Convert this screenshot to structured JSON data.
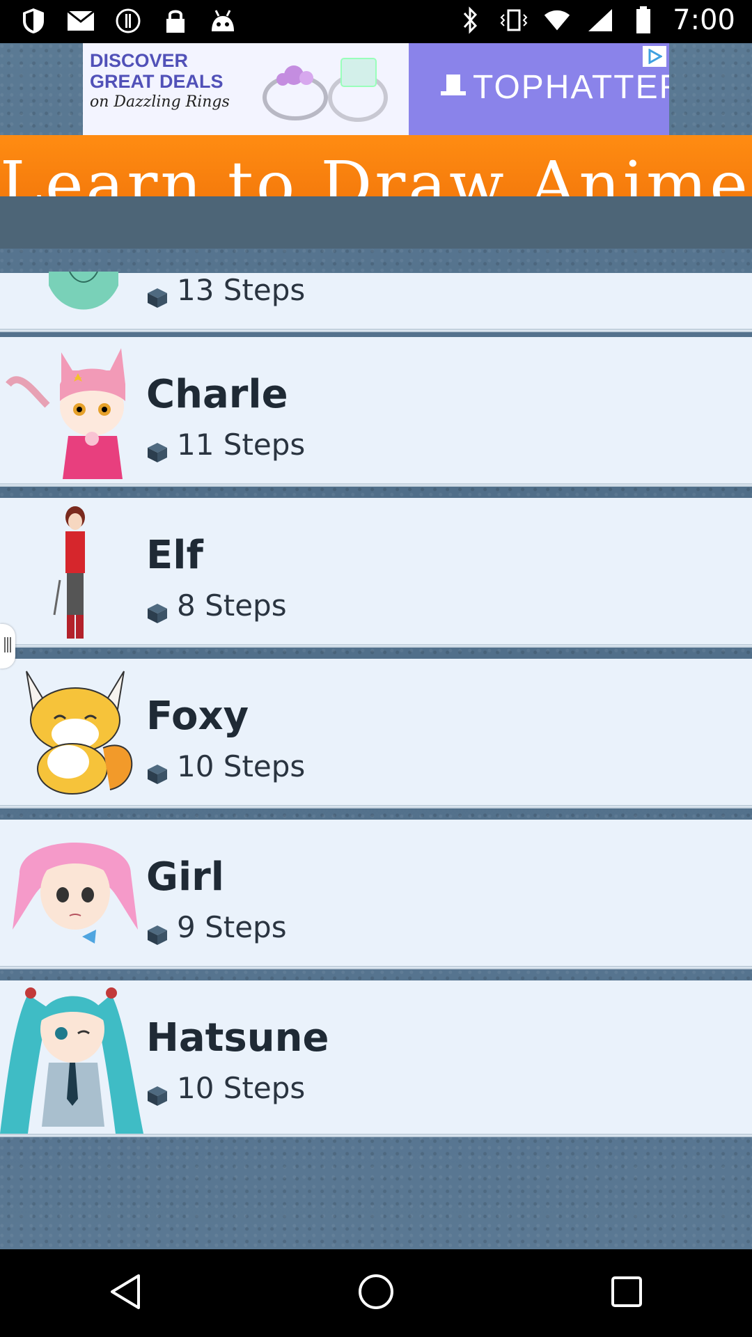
{
  "status_bar": {
    "time": "7:00",
    "left_icons": [
      "shield-icon",
      "mail-icon",
      "alert-icon",
      "lock-icon",
      "android-icon"
    ],
    "right_icons": [
      "bluetooth-icon",
      "vibrate-icon",
      "wifi-icon",
      "signal-icon",
      "battery-icon"
    ]
  },
  "ad": {
    "headline_1": "DISCOVER",
    "headline_2": "GREAT DEALS",
    "headline_3": "on Dazzling Rings",
    "brand": "TOPHATTER",
    "accent": "#8a83ea"
  },
  "header": {
    "title": "Learn to Draw Anime",
    "band_color": "#f57b0c",
    "toolbar_color": "#4d6577"
  },
  "list": {
    "items": [
      {
        "title": "",
        "steps": "13 Steps",
        "thumb": "partial-character"
      },
      {
        "title": "Charle",
        "steps": "11 Steps",
        "thumb": "cat-girl"
      },
      {
        "title": "Elf",
        "steps": "8 Steps",
        "thumb": "elf"
      },
      {
        "title": "Foxy",
        "steps": "10 Steps",
        "thumb": "fox"
      },
      {
        "title": "Girl",
        "steps": "9 Steps",
        "thumb": "pink-hair-girl"
      },
      {
        "title": "Hatsune",
        "steps": "10 Steps",
        "thumb": "teal-twin-tails"
      }
    ]
  },
  "nav": {
    "buttons": [
      "back-icon",
      "home-icon",
      "recents-icon"
    ]
  }
}
